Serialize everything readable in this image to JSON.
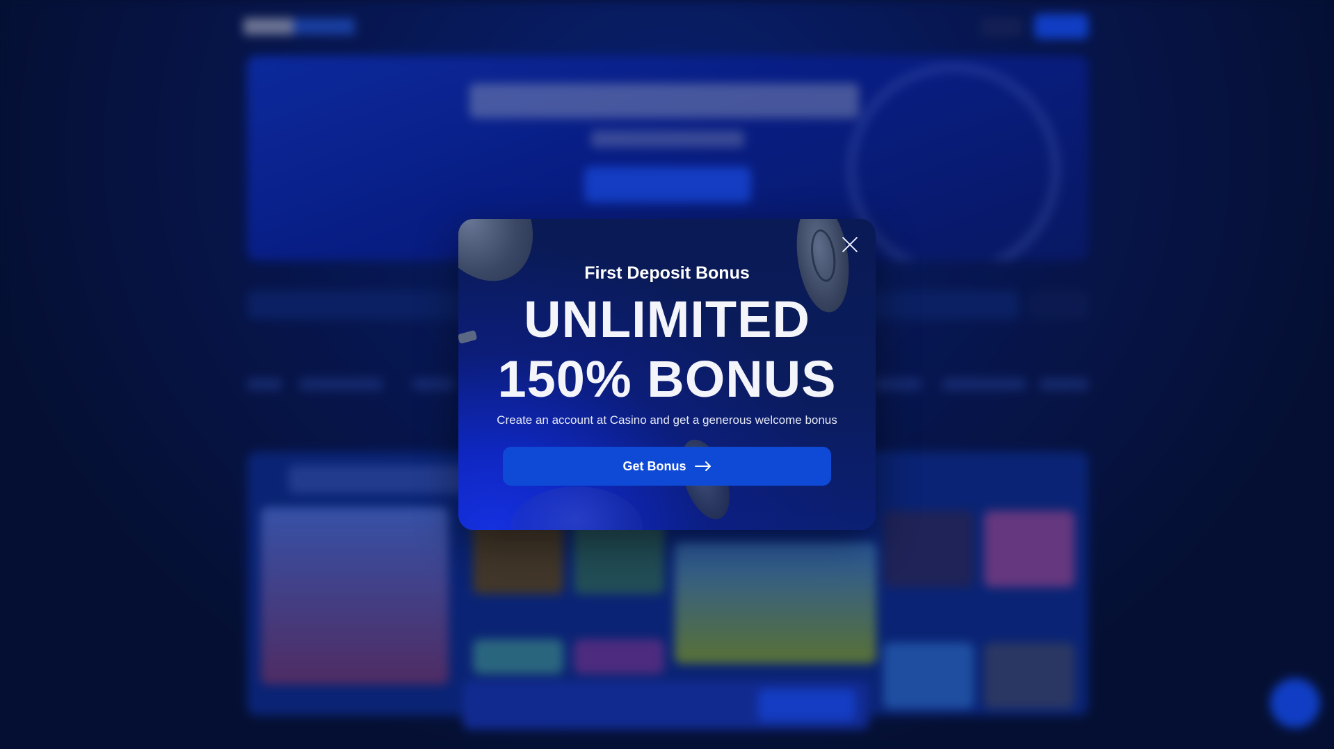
{
  "modal": {
    "subtitle": "First Deposit Bonus",
    "title_line1": "UNLIMITED",
    "title_line2": "150% BONUS",
    "description": "Create an account at Casino and get a generous welcome bonus",
    "cta_label": "Get Bonus",
    "icons": {
      "close": "close-icon",
      "cta_arrow": "arrow-right-icon"
    }
  },
  "colors": {
    "page_background": "#061338",
    "modal_background": "#0a1a55",
    "cta_background": "#0f4ad6",
    "text_primary": "#ffffff"
  }
}
